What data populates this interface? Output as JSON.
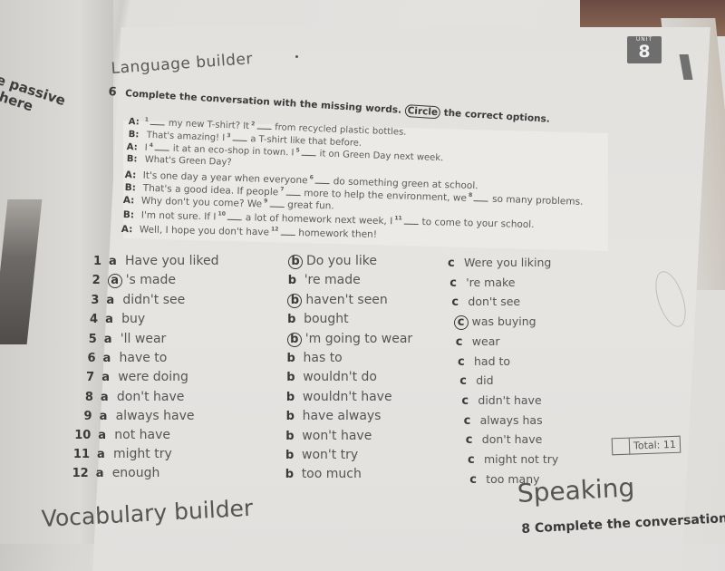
{
  "left_page": {
    "text_line1": "le passive",
    "text_line2": "where"
  },
  "unit_badge": {
    "label": "UNIT",
    "number": "8"
  },
  "language_builder": {
    "title": "Language builder",
    "exercise_number": "6",
    "instruction_before": "Complete the conversation with the missing words.",
    "instruction_circle_word": "Circle",
    "instruction_after": "the correct options."
  },
  "dialogue": [
    {
      "speaker": "A:",
      "parts": [
        "",
        "1",
        "my new T-shirt? It",
        "2",
        "from recycled plastic bottles."
      ]
    },
    {
      "speaker": "B:",
      "parts": [
        "That's amazing! I",
        "3",
        "a T-shirt like that before."
      ]
    },
    {
      "speaker": "A:",
      "parts": [
        "I",
        "4",
        "it at an eco-shop in town. I",
        "5",
        "it on Green Day next week."
      ]
    },
    {
      "speaker": "B:",
      "parts": [
        "What's Green Day?"
      ]
    },
    {
      "speaker": "A:",
      "parts": [
        "It's one day a year when everyone",
        "6",
        "do something green at school."
      ]
    },
    {
      "speaker": "B:",
      "parts": [
        "That's a good idea. If people",
        "7",
        "more to help the environment, we",
        "8",
        "so many problems."
      ]
    },
    {
      "speaker": "A:",
      "parts": [
        "Why don't you come? We",
        "9",
        "great fun."
      ]
    },
    {
      "speaker": "B:",
      "parts": [
        "I'm not sure. If I",
        "10",
        "a lot of homework next week, I",
        "11",
        "to come to your school."
      ]
    },
    {
      "speaker": "A:",
      "parts": [
        "Well, I hope you don't have",
        "12",
        "homework then!"
      ]
    }
  ],
  "options": [
    {
      "num": "1",
      "a": "Have you liked",
      "b": "Do you like",
      "c": "Were you liking",
      "circled": "b"
    },
    {
      "num": "2",
      "a": "'s made",
      "b": "'re made",
      "c": "'re make",
      "circled": "a"
    },
    {
      "num": "3",
      "a": "didn't see",
      "b": "haven't seen",
      "c": "don't see",
      "circled": "b"
    },
    {
      "num": "4",
      "a": "buy",
      "b": "bought",
      "c": "was buying",
      "circled": "c"
    },
    {
      "num": "5",
      "a": "'ll wear",
      "b": "'m going to wear",
      "c": "wear",
      "circled": "b"
    },
    {
      "num": "6",
      "a": "have to",
      "b": "has to",
      "c": "had to",
      "circled": ""
    },
    {
      "num": "7",
      "a": "were doing",
      "b": "wouldn't do",
      "c": "did",
      "circled": ""
    },
    {
      "num": "8",
      "a": "don't have",
      "b": "wouldn't have",
      "c": "didn't have",
      "circled": ""
    },
    {
      "num": "9",
      "a": "always have",
      "b": "have always",
      "c": "always has",
      "circled": ""
    },
    {
      "num": "10",
      "a": "not have",
      "b": "won't have",
      "c": "don't have",
      "circled": ""
    },
    {
      "num": "11",
      "a": "might try",
      "b": "won't try",
      "c": "might not try",
      "circled": ""
    },
    {
      "num": "12",
      "a": "enough",
      "b": "too much",
      "c": "too many",
      "circled": ""
    }
  ],
  "letters": {
    "a": "a",
    "b": "b",
    "c": "c"
  },
  "total": {
    "label": "Total: 11"
  },
  "vocabulary_builder": {
    "title": "Vocabulary builder"
  },
  "speaking": {
    "title": "Speaking",
    "exercise_number": "8",
    "instruction": "Complete the conversation"
  }
}
